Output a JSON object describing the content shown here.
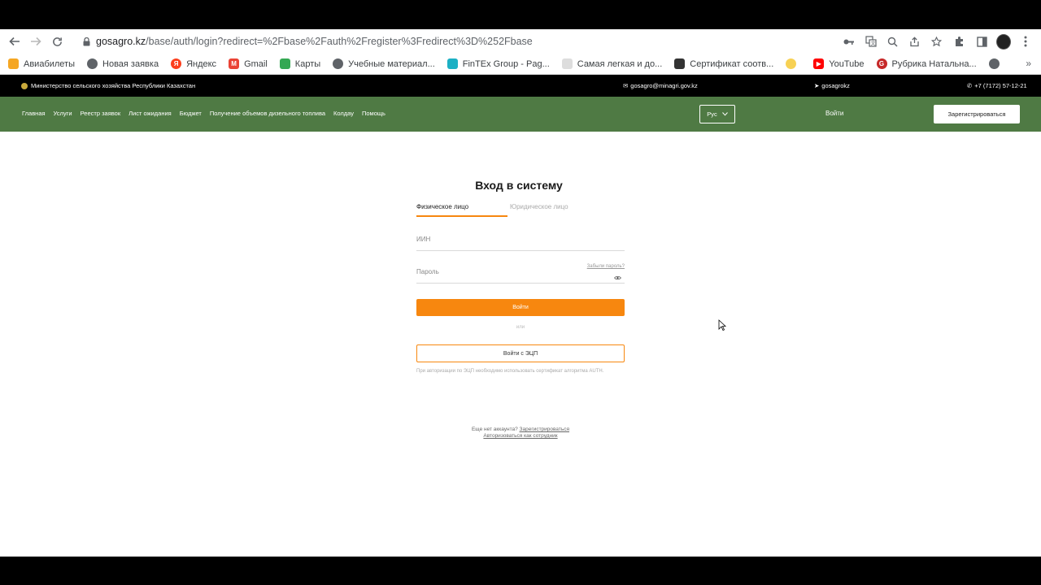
{
  "browser": {
    "url_host": "gosagro.kz",
    "url_path": "/base/auth/login?redirect=%2Fbase%2Fauth%2Fregister%3Fredirect%3D%252Fbase",
    "bookmarks": [
      {
        "label": "Авиабилеты",
        "color": "#f5a623"
      },
      {
        "label": "Новая заявка",
        "color": "#5f6368"
      },
      {
        "label": "Яндекс",
        "color": "#fc3f1d"
      },
      {
        "label": "Gmail",
        "color": "#ea4335"
      },
      {
        "label": "Карты",
        "color": "#34a853"
      },
      {
        "label": "Учебные материал...",
        "color": "#5f6368"
      },
      {
        "label": "FinTEx Group - Pag...",
        "color": "#1cb0c4"
      },
      {
        "label": "Самая легкая и до...",
        "color": "#bbbbbb"
      },
      {
        "label": "Сертификат соотв...",
        "color": "#333333"
      },
      {
        "label": "",
        "color": "#f7d154"
      },
      {
        "label": "YouTube",
        "color": "#ff0000"
      },
      {
        "label": "Рубрика Натальна...",
        "color": "#c62828"
      },
      {
        "label": "",
        "color": "#5f6368"
      }
    ],
    "more_label": "»"
  },
  "site": {
    "ministry": "Министерство сельского хозяйства Республики Казахстан",
    "email": "gosagro@minagri.gov.kz",
    "telegram": "gosagrokz",
    "phone": "+7 (7172) 57-12-21",
    "menu": [
      "Главная",
      "Услуги",
      "Реестр заявок",
      "Лист ожидания",
      "Бюджет",
      "Получение объемов дизельного топлива",
      "Колдау",
      "Помощь"
    ],
    "lang": "Рус",
    "login_link": "Войти",
    "register_button": "Зарегистрироваться"
  },
  "login": {
    "title": "Вход в систему",
    "tab_individual": "Физическое лицо",
    "tab_legal": "Юридическое лицо",
    "iin_label": "ИИН",
    "password_label": "Пароль",
    "forgot": "Забыли пароль?",
    "submit": "Войти",
    "or": "или",
    "ecp_button": "Войти с ЭЦП",
    "hint": "При авторизации по ЭЦП необходимо использовать сертификат алгоритма AUTH.",
    "no_account": "Еще нет аккаунта?",
    "register_link": "Зарегистрироваться",
    "employee_link": "Авторизоваться как сотрудник"
  },
  "colors": {
    "accent": "#f7870f",
    "green": "#4f7a44"
  }
}
